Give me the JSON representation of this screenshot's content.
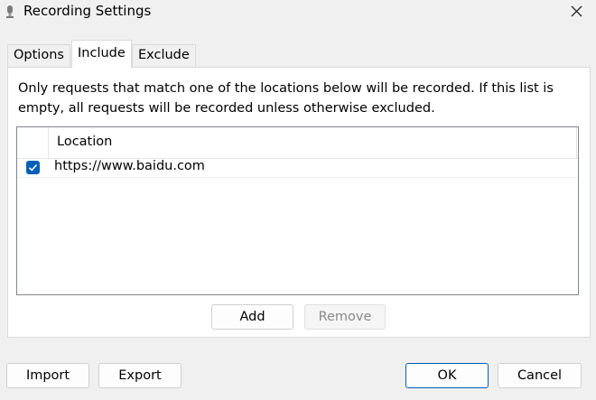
{
  "window": {
    "title": "Recording Settings",
    "app_icon": "recorder-app-icon",
    "close_icon": "close-icon"
  },
  "tabs": [
    {
      "label": "Options",
      "active": false
    },
    {
      "label": "Include",
      "active": true
    },
    {
      "label": "Exclude",
      "active": false
    }
  ],
  "include_panel": {
    "description": "Only requests that match one of the locations below will be recorded. If this list is empty, all requests will be recorded unless otherwise excluded.",
    "list": {
      "columns": [
        "Location"
      ],
      "rows": [
        {
          "checked": true,
          "location": "https://www.baidu.com"
        }
      ]
    },
    "add_label": "Add",
    "remove_label": "Remove"
  },
  "footer": {
    "import_label": "Import",
    "export_label": "Export",
    "ok_label": "OK",
    "cancel_label": "Cancel"
  },
  "colors": {
    "accent": "#005fb8",
    "window_bg": "#f0f0f0",
    "panel_bg": "#ffffff"
  }
}
